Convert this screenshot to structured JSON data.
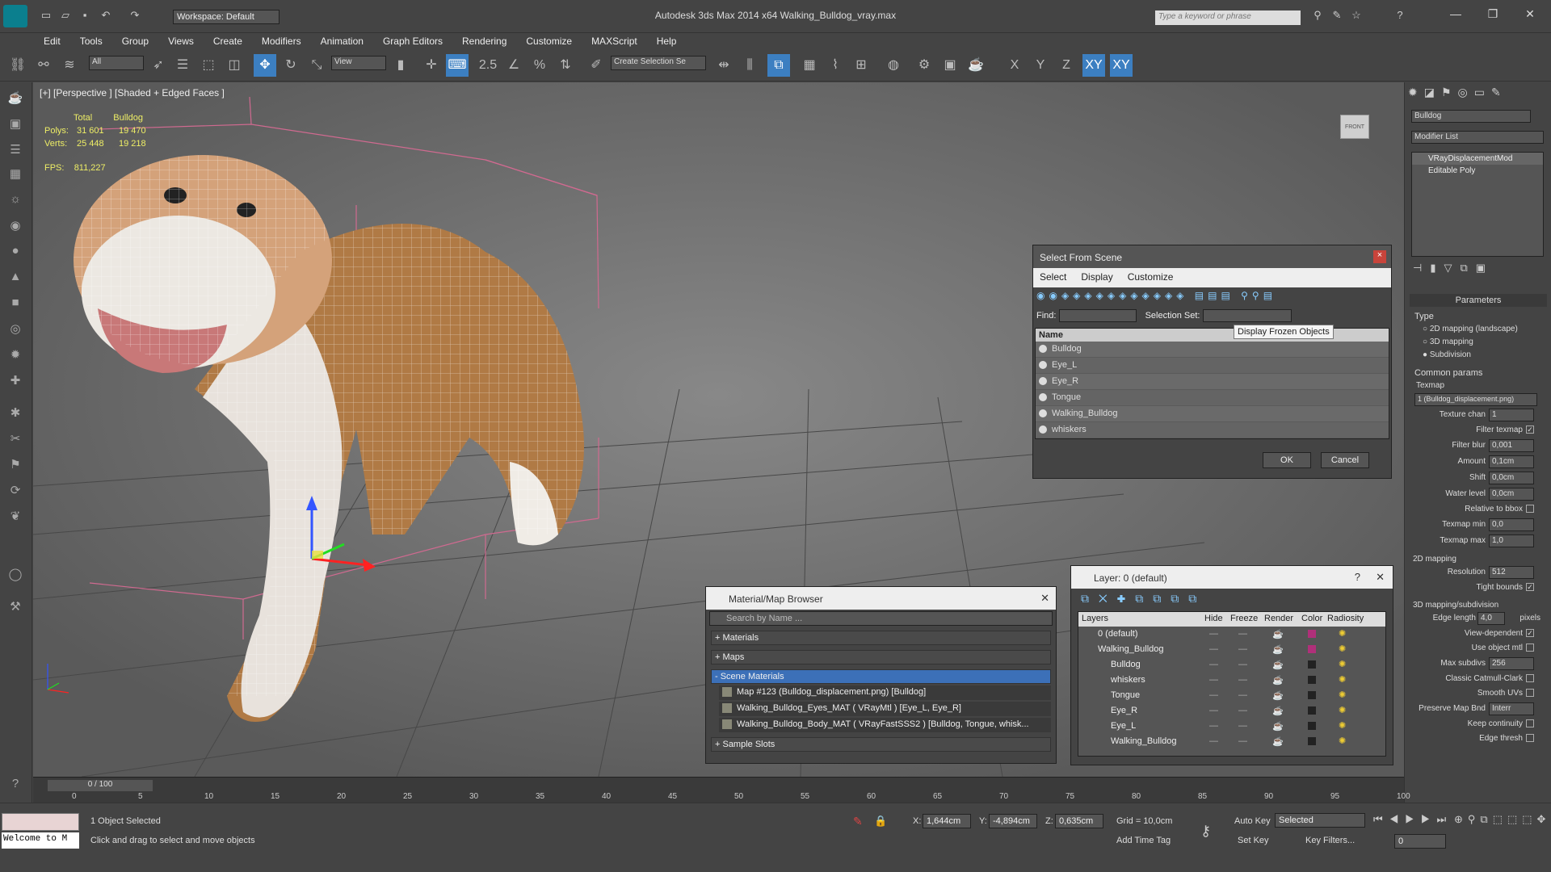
{
  "app": {
    "title": "Autodesk 3ds Max  2014 x64    Walking_Bulldog_vray.max",
    "workspace": "Workspace: Default",
    "keyword_placeholder": "Type a keyword or phrase"
  },
  "menu": [
    "Edit",
    "Tools",
    "Group",
    "Views",
    "Create",
    "Modifiers",
    "Animation",
    "Graph Editors",
    "Rendering",
    "Customize",
    "MAXScript",
    "Help"
  ],
  "toolbar": {
    "selection_filter": "All",
    "ref_coord": "View",
    "angle_snap": "2.5",
    "selection_set_placeholder": "Create Selection Se",
    "axes": [
      "X",
      "Y",
      "Z",
      "XY",
      "XY"
    ]
  },
  "viewport": {
    "label": "[+] [Perspective ] [Shaded + Edged Faces ]",
    "stats": {
      "header_total": "Total",
      "header_bulldog": "Bulldog",
      "polys_label": "Polys:",
      "polys_total": "31 601",
      "polys_bulldog": "19 470",
      "verts_label": "Verts:",
      "verts_total": "25 448",
      "verts_bulldog": "19 218",
      "fps_label": "FPS:",
      "fps_value": "811,227"
    },
    "viewcube": "FRONT"
  },
  "select_dialog": {
    "title": "Select From Scene",
    "menu": [
      "Select",
      "Display",
      "Customize"
    ],
    "find_label": "Find:",
    "selset_label": "Selection Set:",
    "tooltip": "Display Frozen Objects",
    "col_name": "Name",
    "items": [
      "Bulldog",
      "Eye_L",
      "Eye_R",
      "Tongue",
      "Walking_Bulldog",
      "whiskers"
    ],
    "ok": "OK",
    "cancel": "Cancel"
  },
  "mat_browser": {
    "title": "Material/Map Browser",
    "search": "Search by Name ...",
    "groups": [
      "+ Materials",
      "+ Maps",
      "- Scene Materials"
    ],
    "scene_items": [
      "Map #123 (Bulldog_displacement.png) [Bulldog]",
      "Walking_Bulldog_Eyes_MAT  ( VRayMtl )  [Eye_L, Eye_R]",
      "Walking_Bulldog_Body_MAT ( VRayFastSSS2 ) [Bulldog, Tongue, whisk..."
    ],
    "sample": "+ Sample Slots"
  },
  "layer_dialog": {
    "title": "Layer: 0 (default)",
    "cols": [
      "Layers",
      "Hide",
      "Freeze",
      "Render",
      "Color",
      "Radiosity"
    ],
    "rows": [
      {
        "name": "0 (default)",
        "color": "#b0307a"
      },
      {
        "name": "Walking_Bulldog",
        "color": "#b0307a"
      },
      {
        "name": "Bulldog",
        "color": "#222222"
      },
      {
        "name": "whiskers",
        "color": "#222222"
      },
      {
        "name": "Tongue",
        "color": "#222222"
      },
      {
        "name": "Eye_R",
        "color": "#222222"
      },
      {
        "name": "Eye_L",
        "color": "#222222"
      },
      {
        "name": "Walking_Bulldog",
        "color": "#222222"
      }
    ]
  },
  "cmd_panel": {
    "object_name": "Bulldog",
    "modifier_list": "Modifier List",
    "stack": [
      "VRayDisplacementMod",
      "Editable Poly"
    ],
    "rollout": "Parameters",
    "type_label": "Type",
    "type_options": [
      "2D mapping (landscape)",
      "3D mapping",
      "Subdivision"
    ],
    "common_label": "Common params",
    "texmap_label": "Texmap",
    "texmap_value": "1 (Bulldog_displacement.png)",
    "texture_chan_label": "Texture chan",
    "texture_chan": "1",
    "filter_texmap": "Filter texmap",
    "filter_blur_label": "Filter blur",
    "filter_blur": "0,001",
    "amount_label": "Amount",
    "amount": "0,1cm",
    "shift_label": "Shift",
    "shift": "0,0cm",
    "water_label": "Water level",
    "water": "0,0cm",
    "relative_bbox": "Relative to bbox",
    "texmap_min_label": "Texmap min",
    "texmap_min": "0,0",
    "texmap_max_label": "Texmap max",
    "texmap_max": "1,0",
    "mapping2d": "2D mapping",
    "resolution_label": "Resolution",
    "resolution": "512",
    "tight_bounds": "Tight bounds",
    "mapping3d": "3D mapping/subdivision",
    "edge_length_label": "Edge length",
    "edge_length": "4,0",
    "pixels": "pixels",
    "view_dependent": "View-dependent",
    "use_object_mtl": "Use object mtl",
    "max_subdivs_label": "Max subdivs",
    "max_subdivs": "256",
    "classic_catmull": "Classic Catmull-Clark",
    "smooth_uvs": "Smooth UVs",
    "preserve_map": "Preserve Map Bnd",
    "preserve_value": "Interr",
    "keep_continuity": "Keep continuity",
    "edge_thresh": "Edge thresh"
  },
  "timeline": {
    "slider": "0 / 100",
    "ticks": [
      "0",
      "5",
      "10",
      "15",
      "20",
      "25",
      "30",
      "35",
      "40",
      "45",
      "50",
      "55",
      "60",
      "65",
      "70",
      "75",
      "80",
      "85",
      "90",
      "95",
      "100"
    ]
  },
  "status": {
    "welcome": "Welcome to M",
    "selected": "1 Object Selected",
    "prompt": "Click and drag to select and move objects",
    "x_label": "X:",
    "x": "1,644cm",
    "y_label": "Y:",
    "y": "-4,894cm",
    "z_label": "Z:",
    "z": "0,635cm",
    "grid": "Grid = 10,0cm",
    "add_time_tag": "Add Time Tag",
    "auto_key": "Auto Key",
    "set_key": "Set Key",
    "key_mode": "Selected",
    "key_filters": "Key Filters...",
    "frame": "0"
  }
}
